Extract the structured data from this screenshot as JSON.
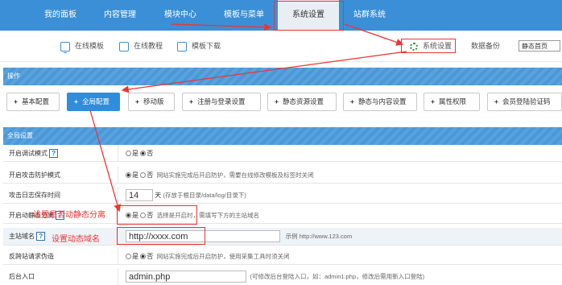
{
  "topnav": {
    "items": [
      "我的面板",
      "内容管理",
      "模块中心",
      "模板与菜单",
      "系统设置",
      "站群系统"
    ]
  },
  "subbar": {
    "links": [
      "在线模板",
      "在线教程",
      "模板下载"
    ],
    "system_settings": "系统设置",
    "data_backup": "数据备份",
    "static_homepage": "静态首页"
  },
  "sections": {
    "operations": "操作",
    "global_settings": "全局设置"
  },
  "tabs": [
    "基本配置",
    "全局配置",
    "移动版",
    "注册与登录设置",
    "静态资源设置",
    "静态与内容设置",
    "属性权限",
    "会员登陆验证码"
  ],
  "settings": {
    "rows": [
      {
        "label": "开启调试模式",
        "yes": "是",
        "no": "否"
      },
      {
        "label": "开启攻击防护模式",
        "yes": "是",
        "no": "否",
        "hint": "网站实施完成后开启防护，需要在线修改模板及标签时关闭"
      },
      {
        "label": "攻击日志保存时间",
        "value": "14",
        "unit": "天",
        "hint": "(存放于根目录/data/log/目录下)"
      },
      {
        "label": "开启动静态分离",
        "yes": "是",
        "no": "否",
        "hint": "选择是开启时，需填写下方的主站域名"
      },
      {
        "label": "主站域名",
        "value": "http://xxxx.com",
        "hint": "示例 http://www.123.com"
      },
      {
        "label": "反跨站请求伪造",
        "yes": "是",
        "no": "否",
        "hint": "网站实施完成后开启防护，使用采集工具时须关闭"
      },
      {
        "label": "后台入口",
        "value": "admin.php",
        "hint": "(可修改后台登陆入口，如：admin1.php，修改后需用新入口登陆)"
      }
    ]
  },
  "annotations": {
    "static_sep_note": "设置是否动静态分离",
    "domain_note": "设置动态域名"
  }
}
